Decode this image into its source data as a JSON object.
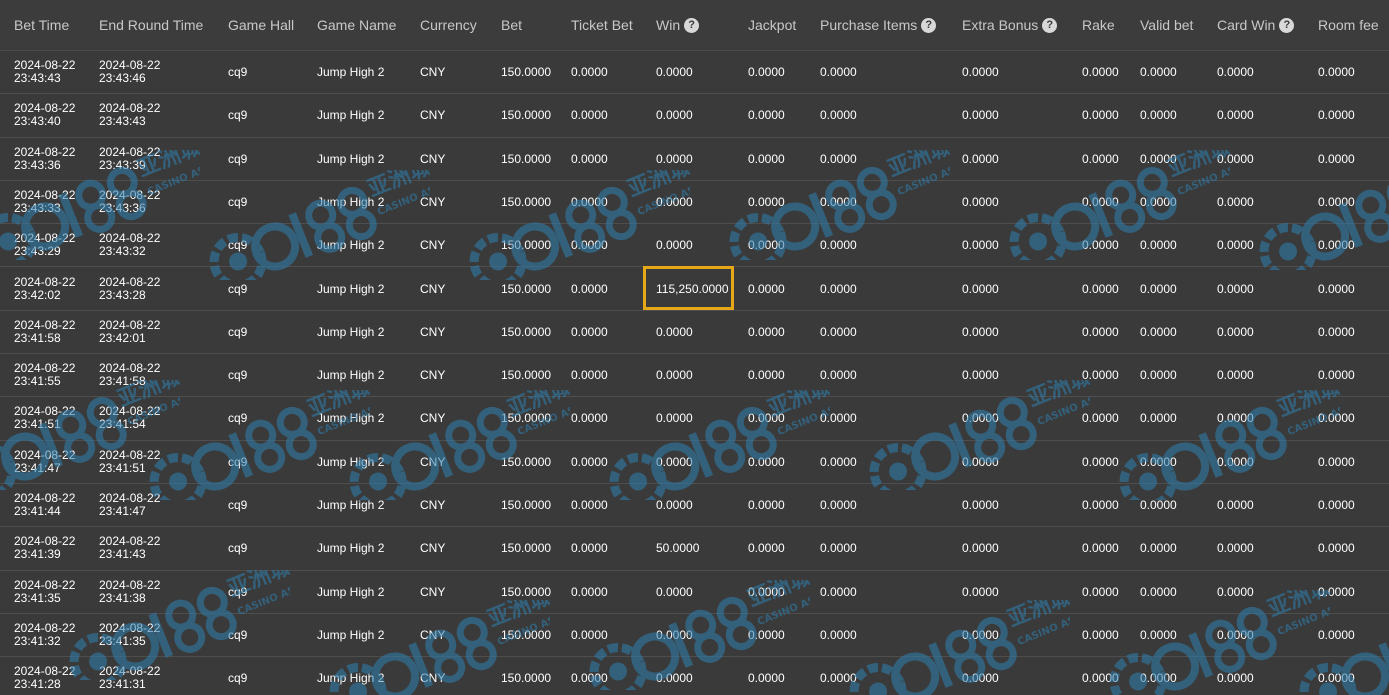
{
  "columns": [
    {
      "label": "Bet Time",
      "help": false
    },
    {
      "label": "End Round Time",
      "help": false
    },
    {
      "label": "Game Hall",
      "help": false
    },
    {
      "label": "Game Name",
      "help": false
    },
    {
      "label": "Currency",
      "help": false
    },
    {
      "label": "Bet",
      "help": false
    },
    {
      "label": "Ticket Bet",
      "help": false
    },
    {
      "label": "Win",
      "help": true
    },
    {
      "label": "Jackpot",
      "help": false
    },
    {
      "label": "Purchase Items",
      "help": true
    },
    {
      "label": "Extra Bonus",
      "help": true
    },
    {
      "label": "Rake",
      "help": false
    },
    {
      "label": "Valid bet",
      "help": false
    },
    {
      "label": "Card Win",
      "help": true
    },
    {
      "label": "Room fee",
      "help": false
    }
  ],
  "help_glyph": "?",
  "highlight_row_index": 5,
  "highlight_column": "Win",
  "highlight_color": "#e6a817",
  "watermark": {
    "logo": "cq188",
    "cn": "亚洲城",
    "en": "CASINO ASIA",
    "color": "#2f7fb0"
  },
  "rows": [
    {
      "bet_date": "2024-08-22",
      "bet_time": "23:43:43",
      "end_date": "2024-08-22",
      "end_time": "23:43:46",
      "game_hall": "cq9",
      "game_name": "Jump High 2",
      "currency": "CNY",
      "bet": "150.0000",
      "ticket_bet": "0.0000",
      "win": "0.0000",
      "jackpot": "0.0000",
      "purchase_items": "0.0000",
      "extra_bonus": "0.0000",
      "rake": "0.0000",
      "valid_bet": "0.0000",
      "card_win": "0.0000",
      "room_fee": "0.0000"
    },
    {
      "bet_date": "2024-08-22",
      "bet_time": "23:43:40",
      "end_date": "2024-08-22",
      "end_time": "23:43:43",
      "game_hall": "cq9",
      "game_name": "Jump High 2",
      "currency": "CNY",
      "bet": "150.0000",
      "ticket_bet": "0.0000",
      "win": "0.0000",
      "jackpot": "0.0000",
      "purchase_items": "0.0000",
      "extra_bonus": "0.0000",
      "rake": "0.0000",
      "valid_bet": "0.0000",
      "card_win": "0.0000",
      "room_fee": "0.0000"
    },
    {
      "bet_date": "2024-08-22",
      "bet_time": "23:43:36",
      "end_date": "2024-08-22",
      "end_time": "23:43:39",
      "game_hall": "cq9",
      "game_name": "Jump High 2",
      "currency": "CNY",
      "bet": "150.0000",
      "ticket_bet": "0.0000",
      "win": "0.0000",
      "jackpot": "0.0000",
      "purchase_items": "0.0000",
      "extra_bonus": "0.0000",
      "rake": "0.0000",
      "valid_bet": "0.0000",
      "card_win": "0.0000",
      "room_fee": "0.0000"
    },
    {
      "bet_date": "2024-08-22",
      "bet_time": "23:43:33",
      "end_date": "2024-08-22",
      "end_time": "23:43:36",
      "game_hall": "cq9",
      "game_name": "Jump High 2",
      "currency": "CNY",
      "bet": "150.0000",
      "ticket_bet": "0.0000",
      "win": "0.0000",
      "jackpot": "0.0000",
      "purchase_items": "0.0000",
      "extra_bonus": "0.0000",
      "rake": "0.0000",
      "valid_bet": "0.0000",
      "card_win": "0.0000",
      "room_fee": "0.0000"
    },
    {
      "bet_date": "2024-08-22",
      "bet_time": "23:43:29",
      "end_date": "2024-08-22",
      "end_time": "23:43:32",
      "game_hall": "cq9",
      "game_name": "Jump High 2",
      "currency": "CNY",
      "bet": "150.0000",
      "ticket_bet": "0.0000",
      "win": "0.0000",
      "jackpot": "0.0000",
      "purchase_items": "0.0000",
      "extra_bonus": "0.0000",
      "rake": "0.0000",
      "valid_bet": "0.0000",
      "card_win": "0.0000",
      "room_fee": "0.0000"
    },
    {
      "bet_date": "2024-08-22",
      "bet_time": "23:42:02",
      "end_date": "2024-08-22",
      "end_time": "23:43:28",
      "game_hall": "cq9",
      "game_name": "Jump High 2",
      "currency": "CNY",
      "bet": "150.0000",
      "ticket_bet": "0.0000",
      "win": "115,250.0000",
      "jackpot": "0.0000",
      "purchase_items": "0.0000",
      "extra_bonus": "0.0000",
      "rake": "0.0000",
      "valid_bet": "0.0000",
      "card_win": "0.0000",
      "room_fee": "0.0000"
    },
    {
      "bet_date": "2024-08-22",
      "bet_time": "23:41:58",
      "end_date": "2024-08-22",
      "end_time": "23:42:01",
      "game_hall": "cq9",
      "game_name": "Jump High 2",
      "currency": "CNY",
      "bet": "150.0000",
      "ticket_bet": "0.0000",
      "win": "0.0000",
      "jackpot": "0.0000",
      "purchase_items": "0.0000",
      "extra_bonus": "0.0000",
      "rake": "0.0000",
      "valid_bet": "0.0000",
      "card_win": "0.0000",
      "room_fee": "0.0000"
    },
    {
      "bet_date": "2024-08-22",
      "bet_time": "23:41:55",
      "end_date": "2024-08-22",
      "end_time": "23:41:58",
      "game_hall": "cq9",
      "game_name": "Jump High 2",
      "currency": "CNY",
      "bet": "150.0000",
      "ticket_bet": "0.0000",
      "win": "0.0000",
      "jackpot": "0.0000",
      "purchase_items": "0.0000",
      "extra_bonus": "0.0000",
      "rake": "0.0000",
      "valid_bet": "0.0000",
      "card_win": "0.0000",
      "room_fee": "0.0000"
    },
    {
      "bet_date": "2024-08-22",
      "bet_time": "23:41:51",
      "end_date": "2024-08-22",
      "end_time": "23:41:54",
      "game_hall": "cq9",
      "game_name": "Jump High 2",
      "currency": "CNY",
      "bet": "150.0000",
      "ticket_bet": "0.0000",
      "win": "0.0000",
      "jackpot": "0.0000",
      "purchase_items": "0.0000",
      "extra_bonus": "0.0000",
      "rake": "0.0000",
      "valid_bet": "0.0000",
      "card_win": "0.0000",
      "room_fee": "0.0000"
    },
    {
      "bet_date": "2024-08-22",
      "bet_time": "23:41:47",
      "end_date": "2024-08-22",
      "end_time": "23:41:51",
      "game_hall": "cq9",
      "game_name": "Jump High 2",
      "currency": "CNY",
      "bet": "150.0000",
      "ticket_bet": "0.0000",
      "win": "0.0000",
      "jackpot": "0.0000",
      "purchase_items": "0.0000",
      "extra_bonus": "0.0000",
      "rake": "0.0000",
      "valid_bet": "0.0000",
      "card_win": "0.0000",
      "room_fee": "0.0000"
    },
    {
      "bet_date": "2024-08-22",
      "bet_time": "23:41:44",
      "end_date": "2024-08-22",
      "end_time": "23:41:47",
      "game_hall": "cq9",
      "game_name": "Jump High 2",
      "currency": "CNY",
      "bet": "150.0000",
      "ticket_bet": "0.0000",
      "win": "0.0000",
      "jackpot": "0.0000",
      "purchase_items": "0.0000",
      "extra_bonus": "0.0000",
      "rake": "0.0000",
      "valid_bet": "0.0000",
      "card_win": "0.0000",
      "room_fee": "0.0000"
    },
    {
      "bet_date": "2024-08-22",
      "bet_time": "23:41:39",
      "end_date": "2024-08-22",
      "end_time": "23:41:43",
      "game_hall": "cq9",
      "game_name": "Jump High 2",
      "currency": "CNY",
      "bet": "150.0000",
      "ticket_bet": "0.0000",
      "win": "50.0000",
      "jackpot": "0.0000",
      "purchase_items": "0.0000",
      "extra_bonus": "0.0000",
      "rake": "0.0000",
      "valid_bet": "0.0000",
      "card_win": "0.0000",
      "room_fee": "0.0000"
    },
    {
      "bet_date": "2024-08-22",
      "bet_time": "23:41:35",
      "end_date": "2024-08-22",
      "end_time": "23:41:38",
      "game_hall": "cq9",
      "game_name": "Jump High 2",
      "currency": "CNY",
      "bet": "150.0000",
      "ticket_bet": "0.0000",
      "win": "0.0000",
      "jackpot": "0.0000",
      "purchase_items": "0.0000",
      "extra_bonus": "0.0000",
      "rake": "0.0000",
      "valid_bet": "0.0000",
      "card_win": "0.0000",
      "room_fee": "0.0000"
    },
    {
      "bet_date": "2024-08-22",
      "bet_time": "23:41:32",
      "end_date": "2024-08-22",
      "end_time": "23:41:35",
      "game_hall": "cq9",
      "game_name": "Jump High 2",
      "currency": "CNY",
      "bet": "150.0000",
      "ticket_bet": "0.0000",
      "win": "0.0000",
      "jackpot": "0.0000",
      "purchase_items": "0.0000",
      "extra_bonus": "0.0000",
      "rake": "0.0000",
      "valid_bet": "0.0000",
      "card_win": "0.0000",
      "room_fee": "0.0000"
    },
    {
      "bet_date": "2024-08-22",
      "bet_time": "23:41:28",
      "end_date": "2024-08-22",
      "end_time": "23:41:31",
      "game_hall": "cq9",
      "game_name": "Jump High 2",
      "currency": "CNY",
      "bet": "150.0000",
      "ticket_bet": "0.0000",
      "win": "0.0000",
      "jackpot": "0.0000",
      "purchase_items": "0.0000",
      "extra_bonus": "0.0000",
      "rake": "0.0000",
      "valid_bet": "0.0000",
      "card_win": "0.0000",
      "room_fee": "0.0000"
    }
  ]
}
